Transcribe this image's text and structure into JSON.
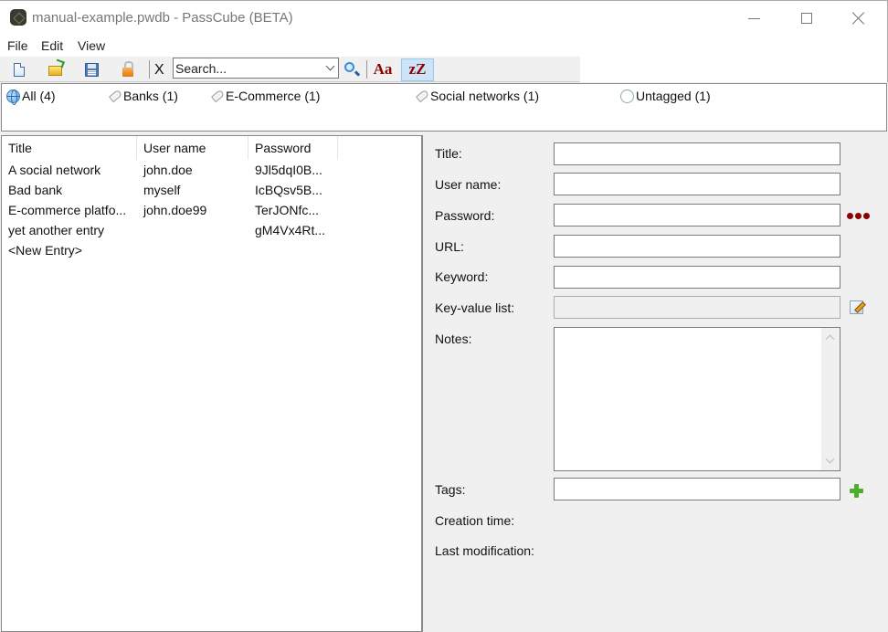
{
  "window": {
    "title": "manual-example.pwdb - PassCube (BETA)",
    "app_icon": "cube-icon",
    "controls": [
      "minimize",
      "maximize",
      "close"
    ]
  },
  "menubar": {
    "items": [
      "File",
      "Edit",
      "View"
    ]
  },
  "toolbar": {
    "buttons": [
      {
        "name": "new",
        "icon": "new-file-icon"
      },
      {
        "name": "open",
        "icon": "open-folder-icon"
      },
      {
        "name": "save",
        "icon": "save-disk-icon"
      },
      {
        "name": "lock",
        "icon": "padlock-icon"
      }
    ],
    "clear_label": "X",
    "search_placeholder": "Search...",
    "search_value": "",
    "search_button_icon": "magnifier-icon",
    "match_case_label": "Aa",
    "sort_label": "zZ",
    "sort_active": true
  },
  "tags": [
    {
      "label": "All (4)",
      "icon": "globe-icon"
    },
    {
      "label": "Banks (1)",
      "icon": "tag-icon"
    },
    {
      "label": "E-Commerce (1)",
      "icon": "tag-icon"
    },
    {
      "label": "Social networks (1)",
      "icon": "tag-icon"
    },
    {
      "label": "Untagged (1)",
      "icon": "circle-icon"
    }
  ],
  "entries": {
    "columns": [
      "Title",
      "User name",
      "Password"
    ],
    "rows": [
      {
        "title": "A social network",
        "user": "john.doe",
        "password": "9Jl5dqI0B..."
      },
      {
        "title": "Bad bank",
        "user": "myself",
        "password": "IcBQsv5B..."
      },
      {
        "title": "E-commerce platfo...",
        "user": "john.doe99",
        "password": "TerJONfc..."
      },
      {
        "title": "yet another entry",
        "user": "",
        "password": "gM4Vx4Rt..."
      },
      {
        "title": "<New Entry>",
        "user": "",
        "password": ""
      }
    ]
  },
  "details": {
    "title_label": "Title:",
    "title_value": "",
    "username_label": "User name:",
    "username_value": "",
    "password_label": "Password:",
    "password_value": "",
    "url_label": "URL:",
    "url_value": "",
    "keyword_label": "Keyword:",
    "keyword_value": "",
    "kv_label": "Key-value list:",
    "kv_value": "",
    "notes_label": "Notes:",
    "notes_value": "",
    "tags_label": "Tags:",
    "tags_value": "",
    "creation_label": "Creation time:",
    "modification_label": "Last modification:"
  },
  "colors": {
    "accent_dark_red": "#8b0000",
    "active_toggle_bg": "#cce4f7",
    "add_green": "#4cae2c"
  }
}
